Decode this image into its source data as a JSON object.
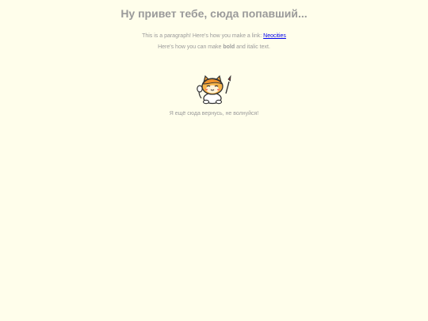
{
  "heading": "Ну привет тебе, сюда попавший...",
  "paragraph1": {
    "text": "This is a paragraph! Here's how you make a link: ",
    "link": "Neocities"
  },
  "paragraph2": {
    "before": "Here's how you can make ",
    "bold": "bold",
    "after": " and italic text."
  },
  "image": {
    "alt": "",
    "icon": "neocities-cat-mascot"
  },
  "paragraph3": "Я ещё сюда вернусь, не волнуйся!",
  "colors": {
    "background": "#fffeeb",
    "text": "#9a9a9a",
    "link": "#0000ee"
  }
}
